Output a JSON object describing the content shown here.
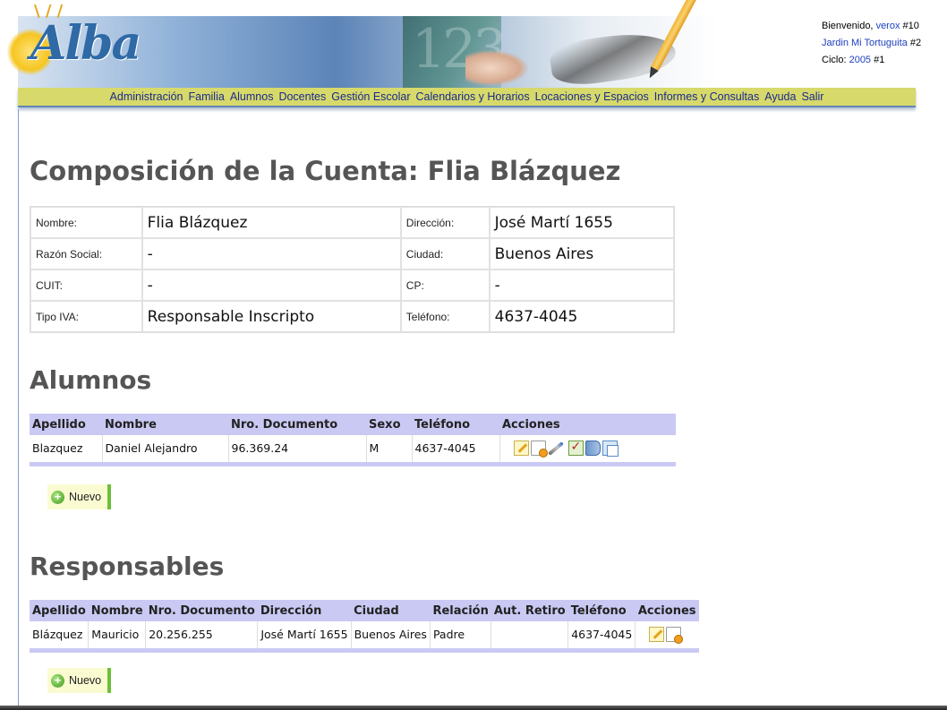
{
  "header": {
    "logo_text": "Alba",
    "welcome_prefix": "Bienvenido,",
    "user": "verox",
    "user_id": "#10",
    "school": "Jardin Mi Tortuguita",
    "school_id": "#2",
    "cycle_label": "Ciclo:",
    "cycle_year": "2005",
    "cycle_id": "#1"
  },
  "menu": [
    "Administración",
    "Familia",
    "Alumnos",
    "Docentes",
    "Gestión Escolar",
    "Calendarios y Horarios",
    "Locaciones y Espacios",
    "Informes y Consultas",
    "Ayuda",
    "Salir"
  ],
  "page_title": "Composición de la Cuenta: Flia Blázquez",
  "account": {
    "nombre_label": "Nombre:",
    "nombre": "Flia Blázquez",
    "direccion_label": "Dirección:",
    "direccion": "José Martí 1655",
    "razon_label": "Razón Social:",
    "razon": "-",
    "ciudad_label": "Ciudad:",
    "ciudad": "Buenos Aires",
    "cuit_label": "CUIT:",
    "cuit": "-",
    "cp_label": "CP:",
    "cp": "-",
    "iva_label": "Tipo IVA:",
    "iva": "Responsable Inscripto",
    "telefono_label": "Teléfono:",
    "telefono": "4637-4045"
  },
  "alumnos": {
    "title": "Alumnos",
    "headers": [
      "Apellido",
      "Nombre",
      "Nro. Documento",
      "Sexo",
      "Teléfono",
      "Acciones"
    ],
    "rows": [
      {
        "apellido": "Blazquez",
        "nombre": "Daniel Alejandro",
        "documento": "96.369.24",
        "sexo": "M",
        "telefono": "4637-4045"
      }
    ],
    "icons": [
      "edit-icon",
      "document-icon",
      "syringe-icon",
      "checklist-icon",
      "book-icon",
      "copy-icon"
    ],
    "nuevo_label": "Nuevo"
  },
  "responsables": {
    "title": "Responsables",
    "headers": [
      "Apellido",
      "Nombre",
      "Nro. Documento",
      "Dirección",
      "Ciudad",
      "Relación",
      "Aut. Retiro",
      "Teléfono",
      "Acciones"
    ],
    "rows": [
      {
        "apellido": "Blázquez",
        "nombre": "Mauricio",
        "documento": "20.256.255",
        "direccion": "José Martí 1655",
        "ciudad": "Buenos Aires",
        "relacion": "Padre",
        "aut_retiro": "",
        "telefono": "4637-4045"
      }
    ],
    "icons": [
      "edit-icon",
      "document-icon"
    ],
    "nuevo_label": "Nuevo"
  }
}
